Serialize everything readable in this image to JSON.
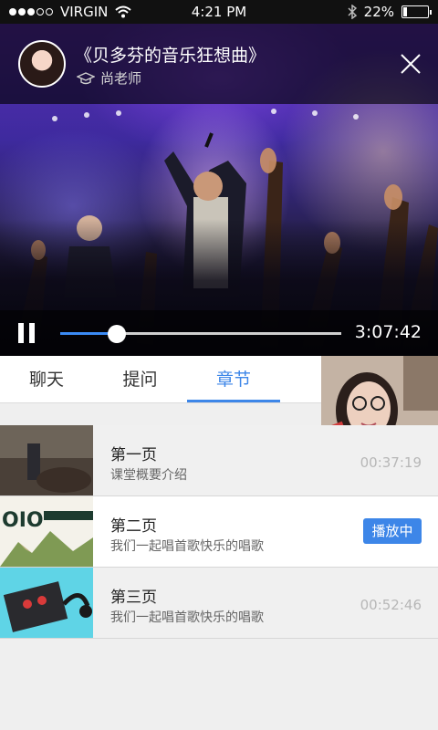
{
  "status_bar": {
    "carrier": "VIRGIN",
    "time": "4:21 PM",
    "battery": "22%",
    "battery_level": 0.22,
    "signal_bars": 3,
    "icons": [
      "signal-dots-icon",
      "wifi-icon",
      "bluetooth-icon",
      "battery-icon"
    ]
  },
  "video": {
    "title": "《贝多芬的音乐狂想曲》",
    "teacher": "尚老师",
    "duration": "3:07:42",
    "progress": 0.2,
    "icons": [
      "graduation-cap-icon",
      "close-icon",
      "pause-icon"
    ]
  },
  "tabs": [
    {
      "label": "聊天"
    },
    {
      "label": "提问"
    },
    {
      "label": "章节"
    }
  ],
  "active_tab": 2,
  "chapters": [
    {
      "title": "第一页",
      "desc": "课堂概要介绍",
      "time": "00:37:19"
    },
    {
      "title": "第二页",
      "desc": "我们一起唱首歌快乐的唱歌",
      "badge": "播放中"
    },
    {
      "title": "第三页",
      "desc": "我们一起唱首歌快乐的唱歌",
      "time": "00:52:46"
    }
  ],
  "colors": {
    "accent": "#3d86e8",
    "badge": "#3d86e8"
  }
}
